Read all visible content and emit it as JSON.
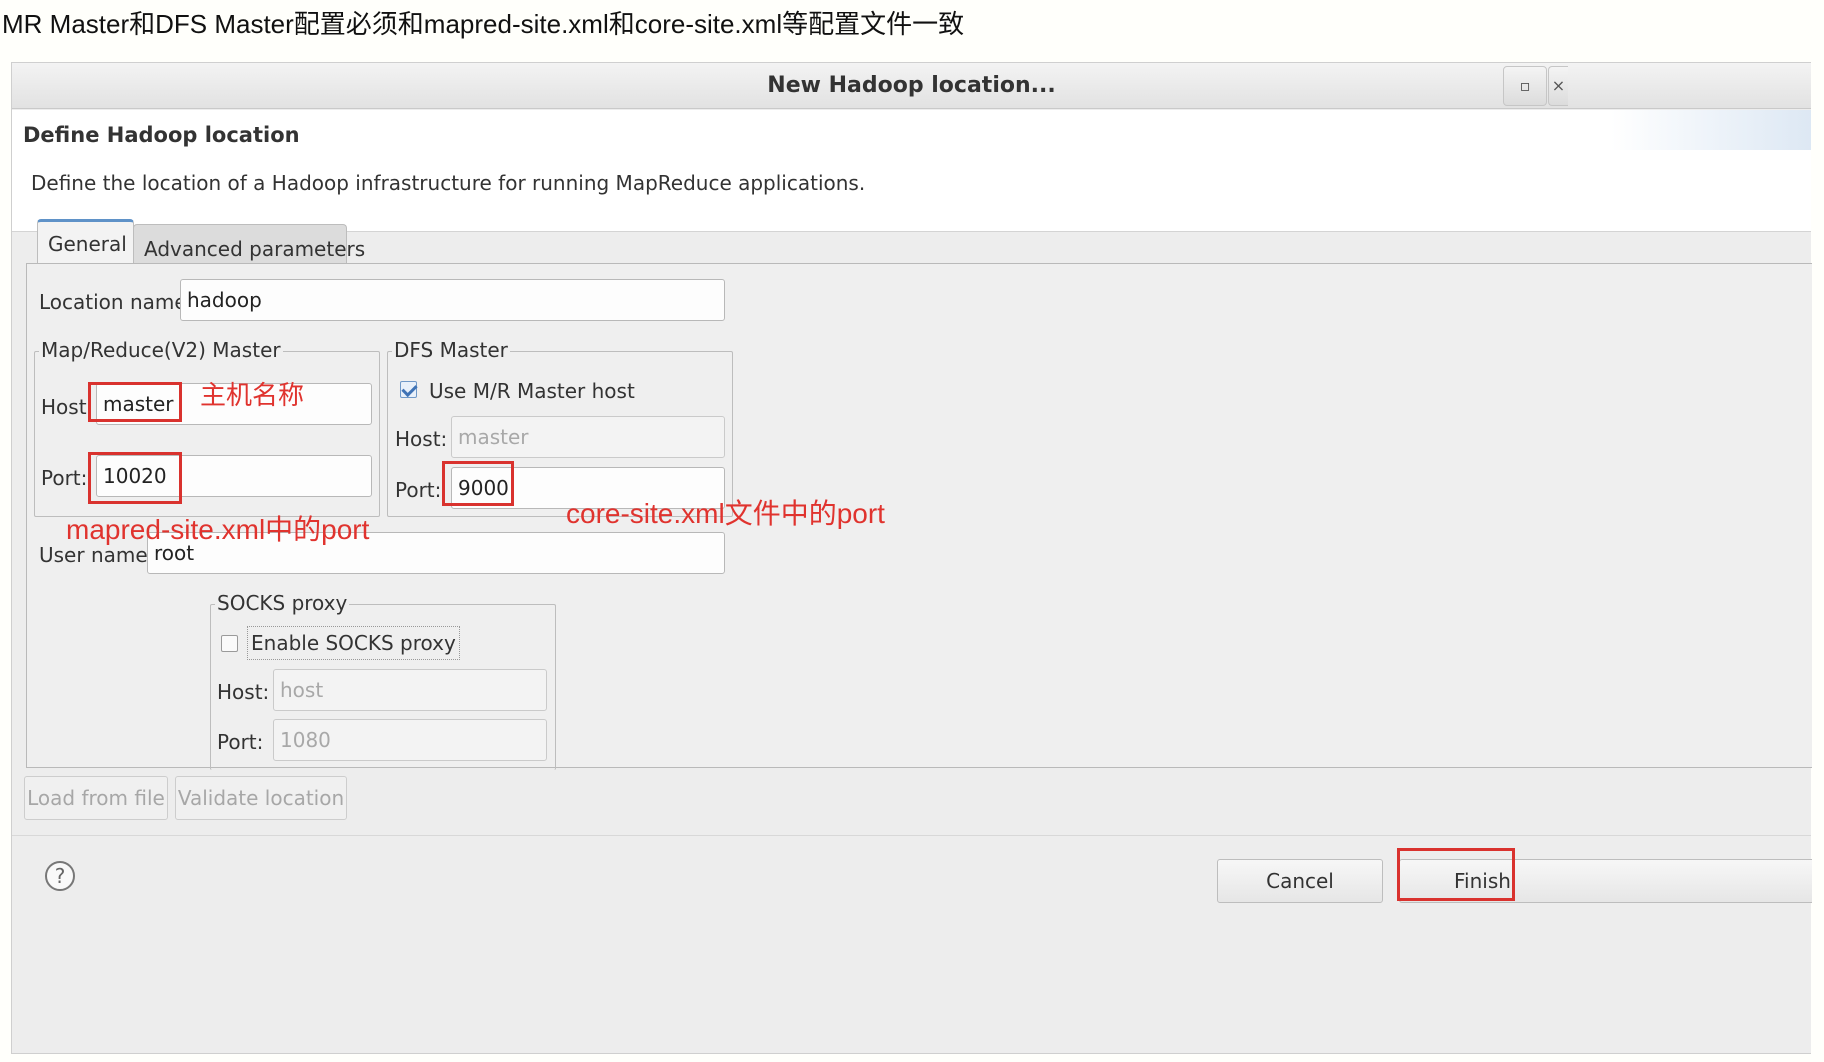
{
  "caption": "MR Master和DFS Master配置必须和mapred-site.xml和core-site.xml等配置文件一致",
  "window": {
    "title": "New Hadoop location...",
    "maximize_glyph": "▫",
    "close_glyph": "×"
  },
  "header": {
    "title": "Define Hadoop location",
    "description": "Define the location of a Hadoop infrastructure for running MapReduce applications."
  },
  "tabs": [
    {
      "label": "General",
      "active": true
    },
    {
      "label": "Advanced parameters",
      "active": false
    }
  ],
  "general": {
    "location_name_label": "Location name:",
    "location_name_value": "hadoop",
    "mr_master": {
      "title": "Map/Reduce(V2) Master",
      "host_label": "Host:",
      "host_value": "master",
      "port_label": "Port:",
      "port_value": "10020"
    },
    "dfs_master": {
      "title": "DFS Master",
      "use_mr_host_label": "Use M/R Master host",
      "use_mr_host_checked": true,
      "host_label": "Host:",
      "host_value": "master",
      "port_label": "Port:",
      "port_value": "9000"
    },
    "user_name_label": "User name:",
    "user_name_value": "root",
    "socks": {
      "title": "SOCKS proxy",
      "enable_label": "Enable SOCKS proxy",
      "enable_checked": false,
      "host_label": "Host:",
      "host_value": "host",
      "port_label": "Port:",
      "port_value": "1080"
    }
  },
  "buttons": {
    "load_from_file": "Load from file",
    "validate_location": "Validate location",
    "cancel": "Cancel",
    "finish": "Finish",
    "help_glyph": "?"
  },
  "annotations": {
    "host_note": "主机名称",
    "mapred_port_note": "mapred-site.xml中的port",
    "core_port_note": "core-site.xml文件中的port",
    "color": "#e0332e"
  }
}
